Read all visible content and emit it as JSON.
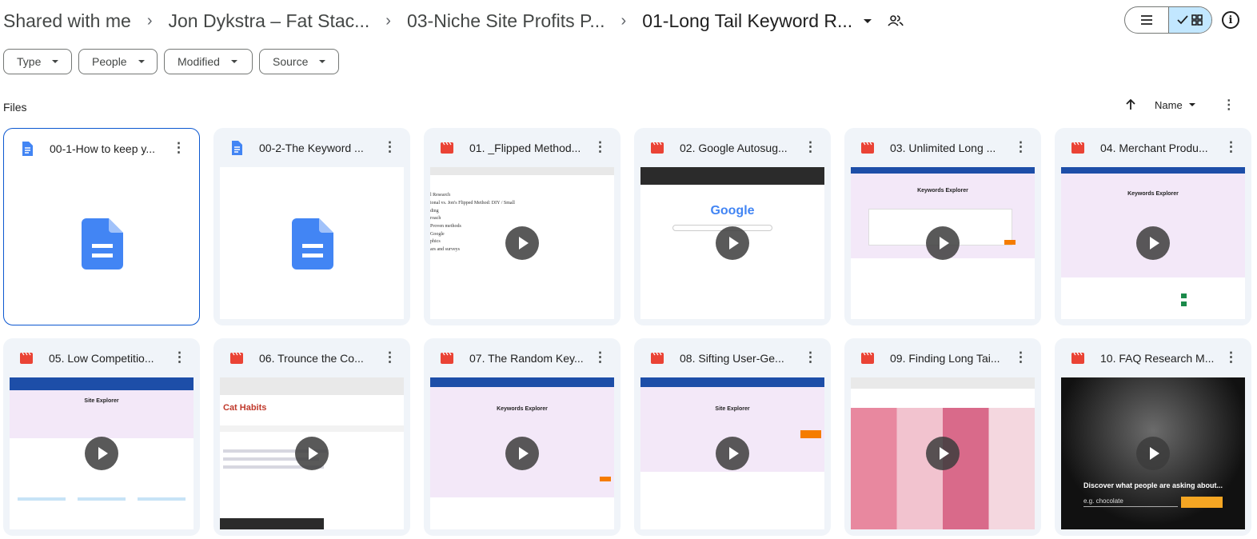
{
  "breadcrumbs": [
    "Shared with me",
    "Jon Dykstra – Fat Stac...",
    "03-Niche Site Profits P...",
    "01-Long Tail Keyword R..."
  ],
  "filters": [
    "Type",
    "People",
    "Modified",
    "Source"
  ],
  "files_label": "Files",
  "sort": {
    "label": "Name"
  },
  "colors": {
    "doc": "#4285f4",
    "video": "#ea4335",
    "accent": "#0b57d0",
    "card_bg": "#f0f4f9"
  },
  "files": [
    {
      "name": "00-1-How to keep y...",
      "type": "doc",
      "icon": "docs-icon"
    },
    {
      "name": "00-2-The Keyword ...",
      "type": "doc",
      "icon": "docs-icon"
    },
    {
      "name": "01. _Flipped Method...",
      "type": "video",
      "icon": "video-icon"
    },
    {
      "name": "02. Google Autosug...",
      "type": "video",
      "icon": "video-icon"
    },
    {
      "name": "03. Unlimited Long ...",
      "type": "video",
      "icon": "video-icon"
    },
    {
      "name": "04. Merchant Produ...",
      "type": "video",
      "icon": "video-icon"
    },
    {
      "name": "05. Low Competitio...",
      "type": "video",
      "icon": "video-icon"
    },
    {
      "name": "06. Trounce the Co...",
      "type": "video",
      "icon": "video-icon"
    },
    {
      "name": "07. The Random Key...",
      "type": "video",
      "icon": "video-icon"
    },
    {
      "name": "08. Sifting User-Ge...",
      "type": "video",
      "icon": "video-icon"
    },
    {
      "name": "09. Finding Long Tai...",
      "type": "video",
      "icon": "video-icon"
    },
    {
      "name": "10. FAQ Research M...",
      "type": "video",
      "icon": "video-icon"
    }
  ],
  "thumbs": {
    "flipped": [
      "l Research",
      "ional vs. Jon's Flipped Method: DIY / Small",
      "ding",
      "roach",
      "Proven methods",
      "Google",
      "phics",
      "ars and surveys"
    ],
    "google_logo": "Google",
    "keywords_explorer": "Keywords Explorer",
    "site_explorer": "Site Explorer",
    "cat_habits": "Cat Habits",
    "faq_caption": "Discover what people are asking about...",
    "faq_search": "e.g. chocolate"
  }
}
